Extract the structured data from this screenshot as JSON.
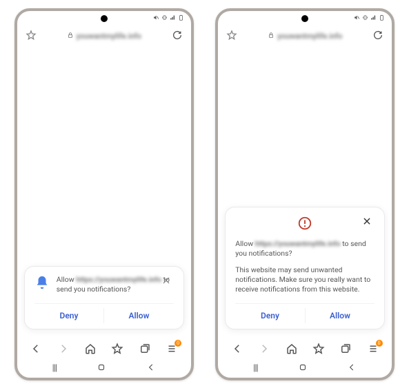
{
  "status": {
    "icons": [
      "volume-mute",
      "vibrate",
      "signal",
      "battery"
    ]
  },
  "addressbar": {
    "url_display": "youwantmylife.info",
    "lock": true
  },
  "phone_left": {
    "prompt": {
      "msg_prefix": "Allow ",
      "msg_domain": "https://youwantmylife.info",
      "msg_suffix": " to send you notifications?",
      "deny_label": "Deny",
      "allow_label": "Allow"
    }
  },
  "phone_right": {
    "prompt": {
      "msg_prefix": "Allow ",
      "msg_domain": "https://youwantmylife.info",
      "msg_suffix": " to send you notifications?",
      "warning_text": "This website may send unwanted notifications. Make sure you really want to receive notifications from this website.",
      "deny_label": "Deny",
      "allow_label": "Allow"
    }
  },
  "toolbar": {
    "badge_count": "0"
  },
  "gestures": {
    "recent": "|||"
  }
}
